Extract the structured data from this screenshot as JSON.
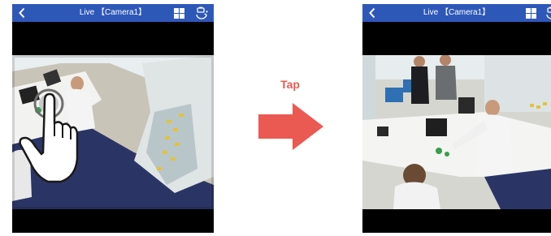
{
  "before": {
    "header": {
      "title": "Live 【Camera1】",
      "back_icon": "chevron-left-icon",
      "layout_icon": "grid-icon",
      "rotate_icon": "camera-rotate-icon"
    },
    "video": {
      "view": "fisheye"
    }
  },
  "after": {
    "header": {
      "title": "Live 【Camera1】",
      "back_icon": "chevron-left-icon",
      "layout_icon": "grid-icon",
      "rotate_icon": "camera-rotate-icon"
    },
    "video": {
      "view": "corrected"
    }
  },
  "transition": {
    "label": "Tap",
    "arrow_icon": "right-arrow-icon",
    "gesture_icon": "tap-hand-icon"
  },
  "colors": {
    "header": "#2e58b8",
    "accent": "#ea5a53",
    "background": "#000000"
  }
}
